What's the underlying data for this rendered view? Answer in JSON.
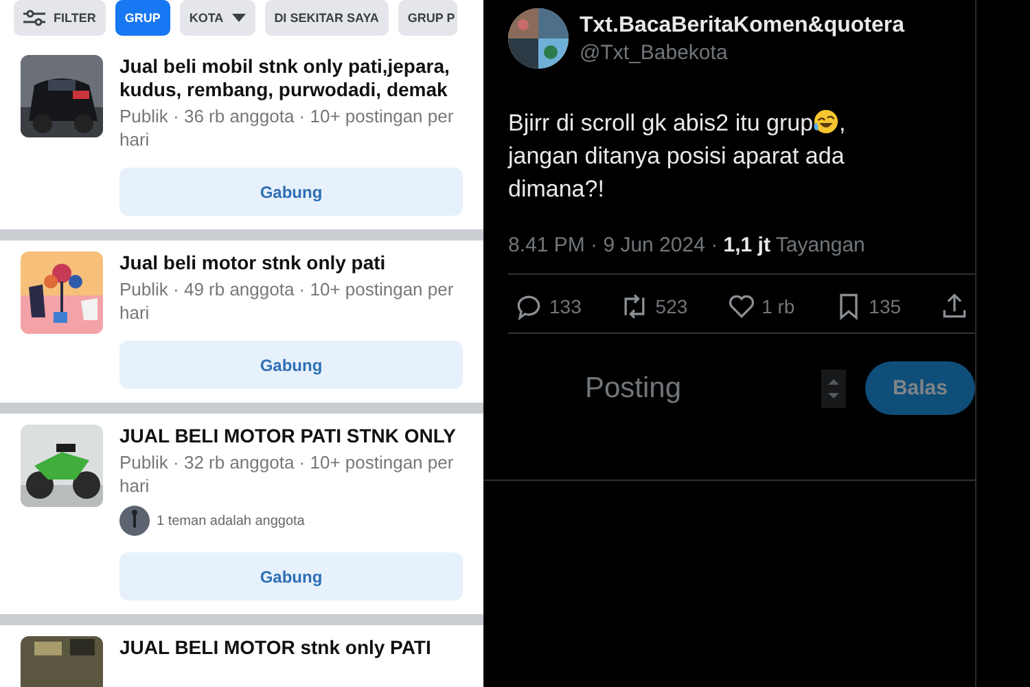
{
  "filters": [
    {
      "label": "FILTER",
      "kind": "filter",
      "selected": false
    },
    {
      "label": "GRUP",
      "kind": "plain",
      "selected": true
    },
    {
      "label": "KOTA",
      "kind": "dropdown",
      "selected": false
    },
    {
      "label": "DI SEKITAR SAYA",
      "kind": "plain",
      "selected": false
    },
    {
      "label": "GRUP P",
      "kind": "plain",
      "selected": false
    }
  ],
  "groups": [
    {
      "name": "Jual beli mobil stnk only pati,jepara, kudus, rembang, purwodadi, demak",
      "meta": "Publik · 36 rb anggota · 10+ postingan per hari",
      "button": "Gabung"
    },
    {
      "name": "Jual beli motor stnk only pati",
      "meta": "Publik · 49 rb anggota · 10+ postingan per hari",
      "button": "Gabung"
    },
    {
      "name": "JUAL BELI MOTOR PATI STNK ONLY",
      "meta": "Publik · 32 rb anggota · 10+ postingan per hari",
      "friends": "1 teman adalah anggota",
      "button": "Gabung"
    },
    {
      "name": "JUAL BELI MOTOR stnk only PATI"
    }
  ],
  "tweet": {
    "name": "Txt.BacaBeritaKomen&quotera",
    "handle": "@Txt_Babekota",
    "text_before": "Bjirr di scroll gk abis2 itu grup",
    "text_mid": ",",
    "text_after": "jangan ditanya posisi aparat ada dimana?!",
    "meta": "8.41 PM · 9 Jun 2024 · **1,1 jt** Tayangan",
    "actions": [
      {
        "kind": "reply",
        "count": "133"
      },
      {
        "kind": "repost",
        "count": "523"
      },
      {
        "kind": "like",
        "count": "1 rb"
      },
      {
        "kind": "bookmark",
        "count": "135"
      },
      {
        "kind": "share"
      }
    ],
    "reply_placeholder": "Posting",
    "reply_button": "Balas"
  }
}
